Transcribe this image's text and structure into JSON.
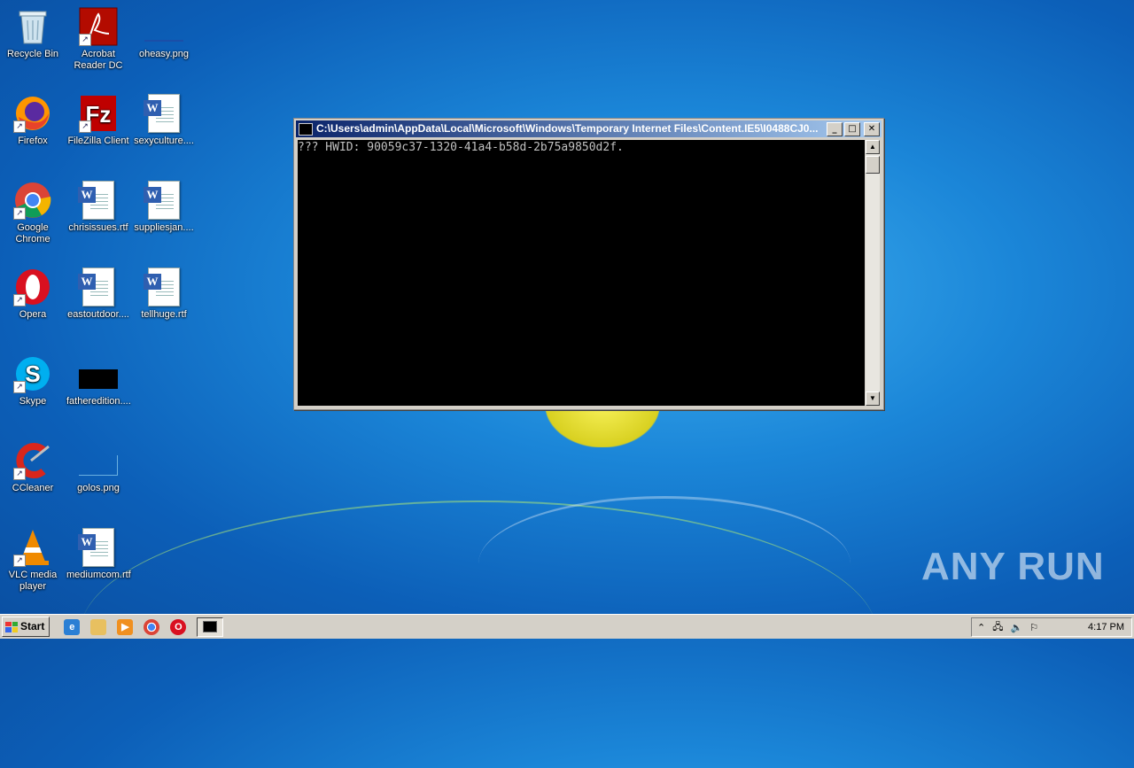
{
  "desktop": {
    "icons": [
      {
        "label": "Recycle Bin"
      },
      {
        "label": "Acrobat Reader DC"
      },
      {
        "label": "oheasy.png"
      },
      {
        "label": "Firefox"
      },
      {
        "label": "FileZilla Client"
      },
      {
        "label": "sexyculture...."
      },
      {
        "label": "Google Chrome"
      },
      {
        "label": "chrisissues.rtf"
      },
      {
        "label": "suppliesjan...."
      },
      {
        "label": "Opera"
      },
      {
        "label": "eastoutdoor...."
      },
      {
        "label": "tellhuge.rtf"
      },
      {
        "label": "Skype"
      },
      {
        "label": "fatheredition...."
      },
      {
        "label": "CCleaner"
      },
      {
        "label": "golos.png"
      },
      {
        "label": "VLC media player"
      },
      {
        "label": "mediumcom.rtf"
      }
    ]
  },
  "console_window": {
    "title": "C:\\Users\\admin\\AppData\\Local\\Microsoft\\Windows\\Temporary Internet Files\\Content.IE5\\I0488CJ0...",
    "output": "??? HWID: 90059c37-1320-41a4-b58d-2b75a9850d2f."
  },
  "taskbar": {
    "start_label": "Start",
    "clock": "4:17 PM"
  },
  "watermark": "ANY RUN",
  "colors": {
    "titlebar_start": "#0a246a",
    "titlebar_end": "#a6caf0",
    "taskbar": "#d4d0c8"
  }
}
